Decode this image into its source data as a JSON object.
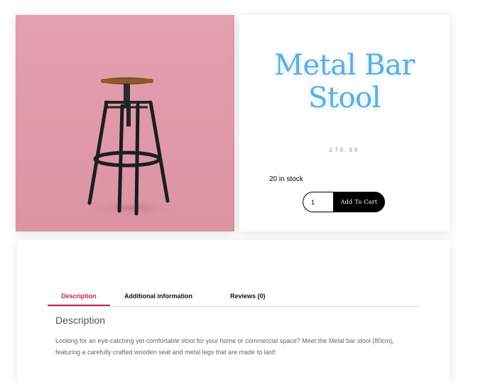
{
  "product": {
    "title_line1": "Metal Bar",
    "title_line2": "Stool",
    "price": "£79.99",
    "stock": "20 in stock",
    "quantity": "1",
    "add_to_cart_label": "Add To Cart"
  },
  "tabs": [
    {
      "label": "Description",
      "active": true
    },
    {
      "label": "Additional information",
      "active": false
    },
    {
      "label": "Reviews (0)",
      "active": false
    }
  ],
  "description": {
    "heading": "Description",
    "text": " Looking for an eye-catching yet comfortable stool for your home or commercial space? Meet the Metal bar stool (80cm), featuring a carefully crafted wooden seat and metal legs that are made to last!"
  },
  "colors": {
    "title": "#5aafe0",
    "active_tab": "#c0244a",
    "photo_background": "#e19aab",
    "button": "#000000"
  }
}
